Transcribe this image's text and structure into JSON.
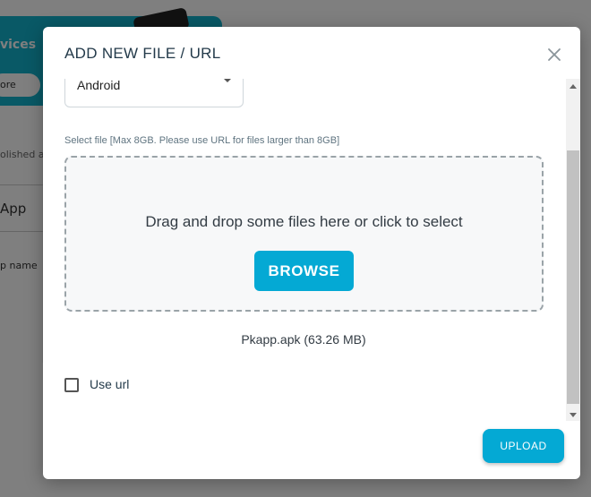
{
  "background": {
    "banner_title": "vices",
    "banner_button": "ore",
    "text_1": "olished ap",
    "app_label": "App",
    "app_name_header": "p name"
  },
  "modal": {
    "title": "ADD NEW FILE / URL",
    "platform_select": {
      "value": "Android"
    },
    "file_label": "Select file [Max 8GB. Please use URL for files larger than 8GB]",
    "dropzone": {
      "text": "Drag and drop some files here or click to select",
      "browse_label": "BROWSE"
    },
    "selected_file": "Pkapp.apk (63.26 MB)",
    "use_url": {
      "label": "Use url",
      "checked": false
    },
    "upload_label": "UPLOAD"
  },
  "colors": {
    "accent": "#04a9d4",
    "overlay": "rgba(0,0,0,0.5)",
    "title": "#233a4a"
  }
}
